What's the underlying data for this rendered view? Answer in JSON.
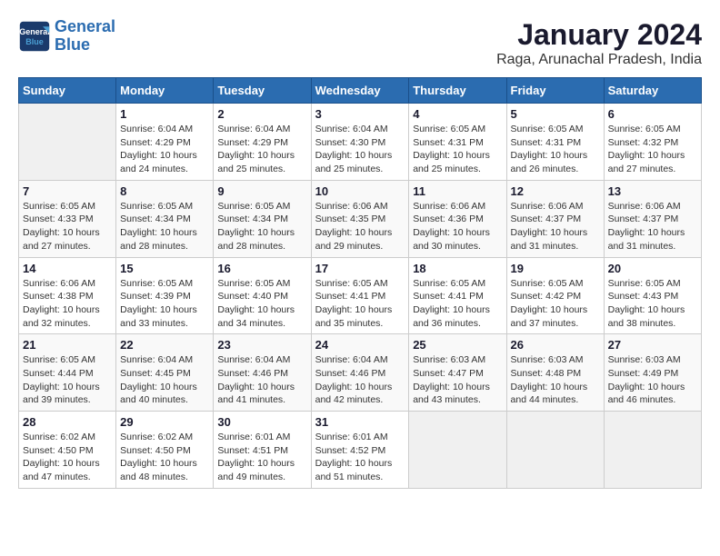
{
  "header": {
    "logo_line1": "General",
    "logo_line2": "Blue",
    "title": "January 2024",
    "subtitle": "Raga, Arunachal Pradesh, India"
  },
  "columns": [
    "Sunday",
    "Monday",
    "Tuesday",
    "Wednesday",
    "Thursday",
    "Friday",
    "Saturday"
  ],
  "weeks": [
    [
      {
        "day": "",
        "sunrise": "",
        "sunset": "",
        "daylight": ""
      },
      {
        "day": "1",
        "sunrise": "Sunrise: 6:04 AM",
        "sunset": "Sunset: 4:29 PM",
        "daylight": "Daylight: 10 hours and 24 minutes."
      },
      {
        "day": "2",
        "sunrise": "Sunrise: 6:04 AM",
        "sunset": "Sunset: 4:29 PM",
        "daylight": "Daylight: 10 hours and 25 minutes."
      },
      {
        "day": "3",
        "sunrise": "Sunrise: 6:04 AM",
        "sunset": "Sunset: 4:30 PM",
        "daylight": "Daylight: 10 hours and 25 minutes."
      },
      {
        "day": "4",
        "sunrise": "Sunrise: 6:05 AM",
        "sunset": "Sunset: 4:31 PM",
        "daylight": "Daylight: 10 hours and 25 minutes."
      },
      {
        "day": "5",
        "sunrise": "Sunrise: 6:05 AM",
        "sunset": "Sunset: 4:31 PM",
        "daylight": "Daylight: 10 hours and 26 minutes."
      },
      {
        "day": "6",
        "sunrise": "Sunrise: 6:05 AM",
        "sunset": "Sunset: 4:32 PM",
        "daylight": "Daylight: 10 hours and 27 minutes."
      }
    ],
    [
      {
        "day": "7",
        "sunrise": "Sunrise: 6:05 AM",
        "sunset": "Sunset: 4:33 PM",
        "daylight": "Daylight: 10 hours and 27 minutes."
      },
      {
        "day": "8",
        "sunrise": "Sunrise: 6:05 AM",
        "sunset": "Sunset: 4:34 PM",
        "daylight": "Daylight: 10 hours and 28 minutes."
      },
      {
        "day": "9",
        "sunrise": "Sunrise: 6:05 AM",
        "sunset": "Sunset: 4:34 PM",
        "daylight": "Daylight: 10 hours and 28 minutes."
      },
      {
        "day": "10",
        "sunrise": "Sunrise: 6:06 AM",
        "sunset": "Sunset: 4:35 PM",
        "daylight": "Daylight: 10 hours and 29 minutes."
      },
      {
        "day": "11",
        "sunrise": "Sunrise: 6:06 AM",
        "sunset": "Sunset: 4:36 PM",
        "daylight": "Daylight: 10 hours and 30 minutes."
      },
      {
        "day": "12",
        "sunrise": "Sunrise: 6:06 AM",
        "sunset": "Sunset: 4:37 PM",
        "daylight": "Daylight: 10 hours and 31 minutes."
      },
      {
        "day": "13",
        "sunrise": "Sunrise: 6:06 AM",
        "sunset": "Sunset: 4:37 PM",
        "daylight": "Daylight: 10 hours and 31 minutes."
      }
    ],
    [
      {
        "day": "14",
        "sunrise": "Sunrise: 6:06 AM",
        "sunset": "Sunset: 4:38 PM",
        "daylight": "Daylight: 10 hours and 32 minutes."
      },
      {
        "day": "15",
        "sunrise": "Sunrise: 6:05 AM",
        "sunset": "Sunset: 4:39 PM",
        "daylight": "Daylight: 10 hours and 33 minutes."
      },
      {
        "day": "16",
        "sunrise": "Sunrise: 6:05 AM",
        "sunset": "Sunset: 4:40 PM",
        "daylight": "Daylight: 10 hours and 34 minutes."
      },
      {
        "day": "17",
        "sunrise": "Sunrise: 6:05 AM",
        "sunset": "Sunset: 4:41 PM",
        "daylight": "Daylight: 10 hours and 35 minutes."
      },
      {
        "day": "18",
        "sunrise": "Sunrise: 6:05 AM",
        "sunset": "Sunset: 4:41 PM",
        "daylight": "Daylight: 10 hours and 36 minutes."
      },
      {
        "day": "19",
        "sunrise": "Sunrise: 6:05 AM",
        "sunset": "Sunset: 4:42 PM",
        "daylight": "Daylight: 10 hours and 37 minutes."
      },
      {
        "day": "20",
        "sunrise": "Sunrise: 6:05 AM",
        "sunset": "Sunset: 4:43 PM",
        "daylight": "Daylight: 10 hours and 38 minutes."
      }
    ],
    [
      {
        "day": "21",
        "sunrise": "Sunrise: 6:05 AM",
        "sunset": "Sunset: 4:44 PM",
        "daylight": "Daylight: 10 hours and 39 minutes."
      },
      {
        "day": "22",
        "sunrise": "Sunrise: 6:04 AM",
        "sunset": "Sunset: 4:45 PM",
        "daylight": "Daylight: 10 hours and 40 minutes."
      },
      {
        "day": "23",
        "sunrise": "Sunrise: 6:04 AM",
        "sunset": "Sunset: 4:46 PM",
        "daylight": "Daylight: 10 hours and 41 minutes."
      },
      {
        "day": "24",
        "sunrise": "Sunrise: 6:04 AM",
        "sunset": "Sunset: 4:46 PM",
        "daylight": "Daylight: 10 hours and 42 minutes."
      },
      {
        "day": "25",
        "sunrise": "Sunrise: 6:03 AM",
        "sunset": "Sunset: 4:47 PM",
        "daylight": "Daylight: 10 hours and 43 minutes."
      },
      {
        "day": "26",
        "sunrise": "Sunrise: 6:03 AM",
        "sunset": "Sunset: 4:48 PM",
        "daylight": "Daylight: 10 hours and 44 minutes."
      },
      {
        "day": "27",
        "sunrise": "Sunrise: 6:03 AM",
        "sunset": "Sunset: 4:49 PM",
        "daylight": "Daylight: 10 hours and 46 minutes."
      }
    ],
    [
      {
        "day": "28",
        "sunrise": "Sunrise: 6:02 AM",
        "sunset": "Sunset: 4:50 PM",
        "daylight": "Daylight: 10 hours and 47 minutes."
      },
      {
        "day": "29",
        "sunrise": "Sunrise: 6:02 AM",
        "sunset": "Sunset: 4:50 PM",
        "daylight": "Daylight: 10 hours and 48 minutes."
      },
      {
        "day": "30",
        "sunrise": "Sunrise: 6:01 AM",
        "sunset": "Sunset: 4:51 PM",
        "daylight": "Daylight: 10 hours and 49 minutes."
      },
      {
        "day": "31",
        "sunrise": "Sunrise: 6:01 AM",
        "sunset": "Sunset: 4:52 PM",
        "daylight": "Daylight: 10 hours and 51 minutes."
      },
      {
        "day": "",
        "sunrise": "",
        "sunset": "",
        "daylight": ""
      },
      {
        "day": "",
        "sunrise": "",
        "sunset": "",
        "daylight": ""
      },
      {
        "day": "",
        "sunrise": "",
        "sunset": "",
        "daylight": ""
      }
    ]
  ]
}
